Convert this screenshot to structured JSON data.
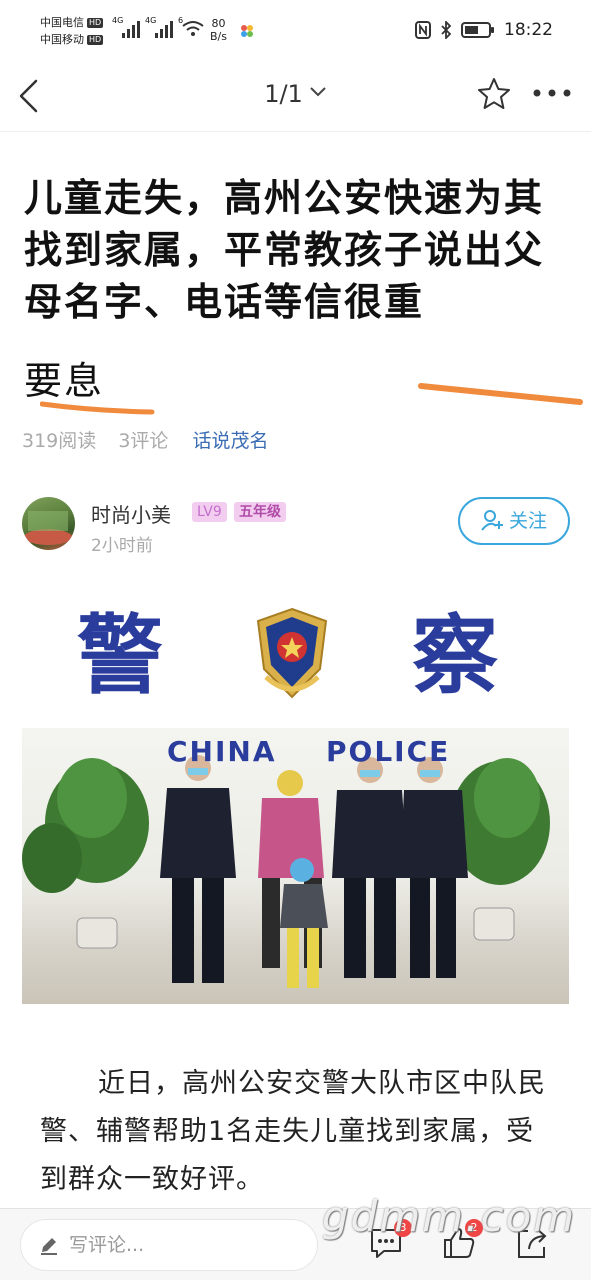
{
  "status_bar": {
    "carrier1": "中国电信",
    "carrier2": "中国移动",
    "hd_badge": "HD",
    "net1": "4G",
    "net2": "4G",
    "net3": "6",
    "speed_value": "80",
    "speed_unit": "B/s",
    "time": "18:22"
  },
  "nav": {
    "page_indicator": "1/1"
  },
  "article": {
    "title": "儿童走失，高州公安快速为其找到家属，平常教孩子说出父母名字、电话等信很重",
    "title_extra": "要息",
    "reads": "319阅读",
    "comments": "3评论",
    "topic": "话说茂名",
    "author": {
      "name": "时尚小美",
      "level": "LV9",
      "grade": "五年级",
      "time": "2小时前",
      "follow_label": "关注"
    },
    "photo": {
      "sign_left": "警",
      "sign_right": "察",
      "text_china": "CHINA",
      "text_police": "POLICE"
    },
    "body": "近日，高州公安交警大队市区中队民警、辅警帮助1名走失儿童找到家属，受到群众一致好评。"
  },
  "bottom_bar": {
    "comment_placeholder": "写评论...",
    "comment_count": "3",
    "like_count": "2",
    "watermark": "gdmm.com"
  },
  "colors": {
    "link": "#3a6db4",
    "follow": "#39a6dd",
    "badge_bg": "#f2cdf0",
    "annotation": "#f08a3c",
    "police_blue": "#2a3c9c"
  }
}
